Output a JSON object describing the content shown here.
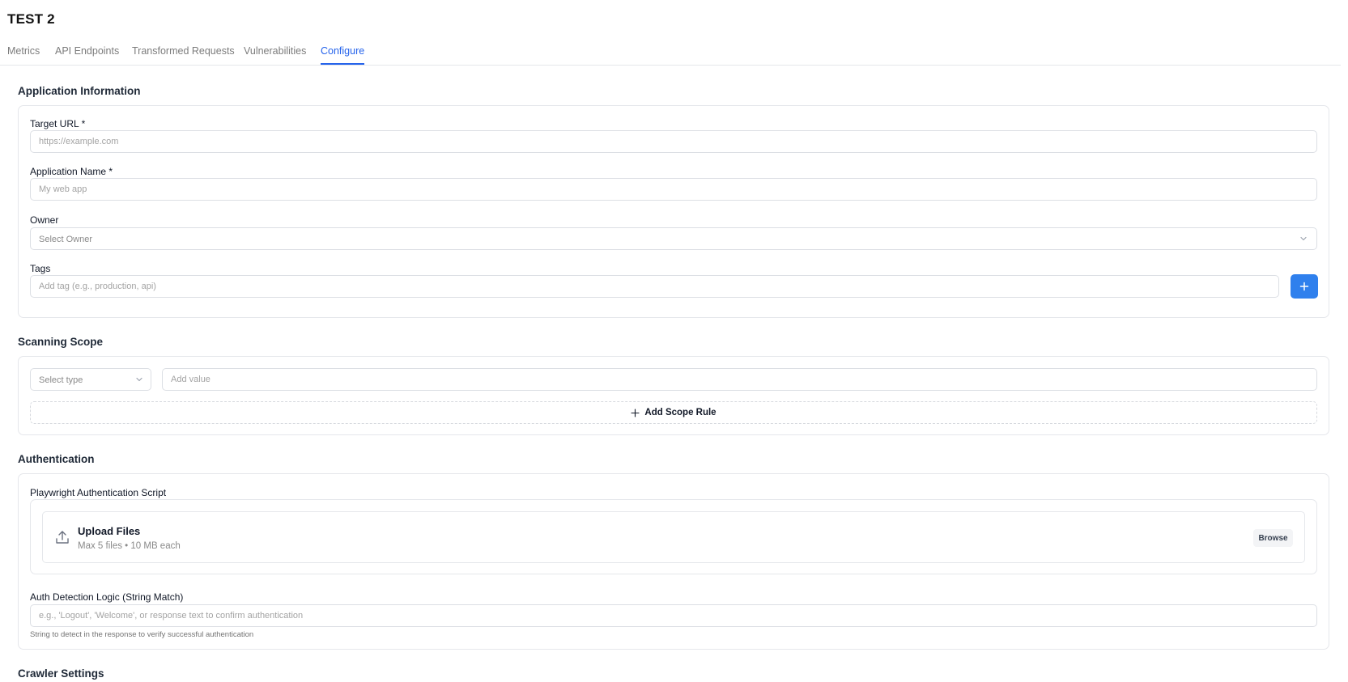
{
  "page": {
    "title": "TEST 2"
  },
  "tabs": [
    {
      "label": "Metrics"
    },
    {
      "label": "API Endpoints"
    },
    {
      "label": "Transformed Requests"
    },
    {
      "label": "Vulnerabilities"
    },
    {
      "label": "Configure",
      "active": true
    }
  ],
  "application": {
    "title": "Application Information",
    "target_url": {
      "label": "Target URL *",
      "placeholder": "https://example.com",
      "value": ""
    },
    "app_name": {
      "label": "Application Name *",
      "placeholder": "My web app",
      "value": ""
    },
    "owner": {
      "label": "Owner",
      "selected": "Select Owner"
    },
    "tags": {
      "label": "Tags",
      "placeholder": "Add tag (e.g., production, api)",
      "value": "",
      "add_icon": "plus-icon"
    }
  },
  "scope": {
    "title": "Scanning Scope",
    "type_select": "Select type",
    "value_placeholder": "Add value",
    "add_rule_label": "Add Scope Rule"
  },
  "auth": {
    "title": "Authentication",
    "script_label": "Playwright Authentication Script",
    "upload_title": "Upload Files",
    "upload_sub": "Max 5 files • 10 MB each",
    "upload_icon": "upload-icon",
    "browse_label": "Browse",
    "detection_label": "Auth Detection Logic (String Match)",
    "detection_placeholder": "e.g., 'Logout', 'Welcome', or response text to confirm authentication",
    "detection_hint": "String to detect in the response to verify successful authentication"
  },
  "crawler": {
    "title": "Crawler Settings"
  },
  "colors": {
    "accent": "#2563eb",
    "button_blue": "#2f80ed",
    "border": "#e5e7eb"
  }
}
